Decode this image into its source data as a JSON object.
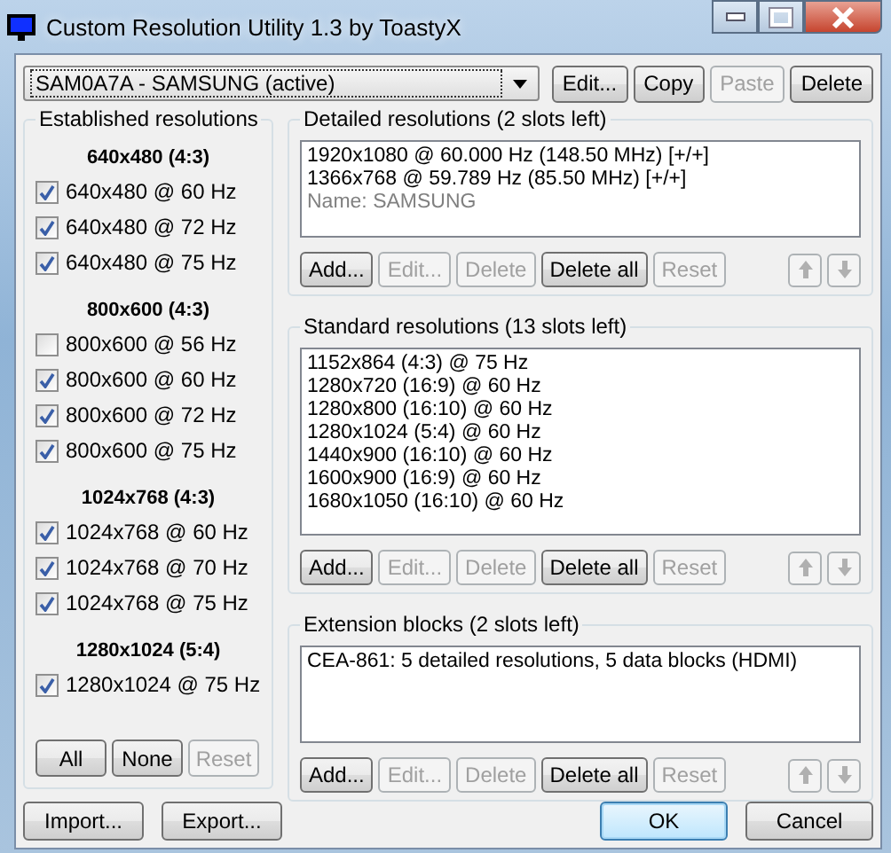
{
  "window": {
    "title": "Custom Resolution Utility 1.3 by ToastyX"
  },
  "device_select": {
    "value": "SAM0A7A - SAMSUNG (active)"
  },
  "top_buttons": [
    {
      "label": "Edit...",
      "disabled": false
    },
    {
      "label": "Copy",
      "disabled": false
    },
    {
      "label": "Paste",
      "disabled": true
    },
    {
      "label": "Delete",
      "disabled": false
    }
  ],
  "established": {
    "title": "Established resolutions",
    "groups": [
      {
        "heading": "640x480 (4:3)",
        "items": [
          {
            "label": "640x480 @ 60 Hz",
            "checked": true
          },
          {
            "label": "640x480 @ 72 Hz",
            "checked": true
          },
          {
            "label": "640x480 @ 75 Hz",
            "checked": true
          }
        ]
      },
      {
        "heading": "800x600 (4:3)",
        "items": [
          {
            "label": "800x600 @ 56 Hz",
            "checked": false
          },
          {
            "label": "800x600 @ 60 Hz",
            "checked": true
          },
          {
            "label": "800x600 @ 72 Hz",
            "checked": true
          },
          {
            "label": "800x600 @ 75 Hz",
            "checked": true
          }
        ]
      },
      {
        "heading": "1024x768 (4:3)",
        "items": [
          {
            "label": "1024x768 @ 60 Hz",
            "checked": true
          },
          {
            "label": "1024x768 @ 70 Hz",
            "checked": true
          },
          {
            "label": "1024x768 @ 75 Hz",
            "checked": true
          }
        ]
      },
      {
        "heading": "1280x1024 (5:4)",
        "items": [
          {
            "label": "1280x1024 @ 75 Hz",
            "checked": true
          }
        ]
      }
    ],
    "buttons": [
      {
        "label": "All",
        "disabled": false
      },
      {
        "label": "None",
        "disabled": false
      },
      {
        "label": "Reset",
        "disabled": true
      }
    ]
  },
  "sections": [
    {
      "title": "Detailed resolutions (2 slots left)",
      "items": [
        {
          "text": "1920x1080 @ 60.000 Hz (148.50 MHz) [+/+]",
          "kind": "normal"
        },
        {
          "text": "1366x768 @ 59.789 Hz (85.50 MHz) [+/+]",
          "kind": "normal"
        },
        {
          "text": "Name: SAMSUNG",
          "kind": "muted"
        }
      ],
      "buttons": [
        {
          "label": "Add...",
          "disabled": false
        },
        {
          "label": "Edit...",
          "disabled": true
        },
        {
          "label": "Delete",
          "disabled": true
        },
        {
          "label": "Delete all",
          "disabled": false
        },
        {
          "label": "Reset",
          "disabled": true
        }
      ],
      "arrows": [
        {
          "kind": "up",
          "disabled": true
        },
        {
          "kind": "down",
          "disabled": true
        }
      ]
    },
    {
      "title": "Standard resolutions (13 slots left)",
      "items": [
        {
          "text": "1152x864 (4:3) @ 75 Hz",
          "kind": "normal"
        },
        {
          "text": "1280x720 (16:9) @ 60 Hz",
          "kind": "normal"
        },
        {
          "text": "1280x800 (16:10) @ 60 Hz",
          "kind": "normal"
        },
        {
          "text": "1280x1024 (5:4) @ 60 Hz",
          "kind": "normal"
        },
        {
          "text": "1440x900 (16:10) @ 60 Hz",
          "kind": "normal"
        },
        {
          "text": "1600x900 (16:9) @ 60 Hz",
          "kind": "normal"
        },
        {
          "text": "1680x1050 (16:10) @ 60 Hz",
          "kind": "normal"
        }
      ],
      "buttons": [
        {
          "label": "Add...",
          "disabled": false
        },
        {
          "label": "Edit...",
          "disabled": true
        },
        {
          "label": "Delete",
          "disabled": true
        },
        {
          "label": "Delete all",
          "disabled": false
        },
        {
          "label": "Reset",
          "disabled": true
        }
      ],
      "arrows": [
        {
          "kind": "up",
          "disabled": true
        },
        {
          "kind": "down",
          "disabled": true
        }
      ]
    },
    {
      "title": "Extension blocks (2 slots left)",
      "items": [
        {
          "text": "CEA-861: 5 detailed resolutions, 5 data blocks (HDMI)",
          "kind": "normal"
        }
      ],
      "buttons": [
        {
          "label": "Add...",
          "disabled": false
        },
        {
          "label": "Edit...",
          "disabled": true
        },
        {
          "label": "Delete",
          "disabled": true
        },
        {
          "label": "Delete all",
          "disabled": false
        },
        {
          "label": "Reset",
          "disabled": true
        }
      ],
      "arrows": [
        {
          "kind": "up",
          "disabled": true
        },
        {
          "kind": "down",
          "disabled": true
        }
      ]
    }
  ],
  "footer_left": [
    {
      "label": "Import..."
    },
    {
      "label": "Export..."
    }
  ],
  "footer_right": [
    {
      "label": "OK",
      "default": true
    },
    {
      "label": "Cancel",
      "default": false
    }
  ]
}
